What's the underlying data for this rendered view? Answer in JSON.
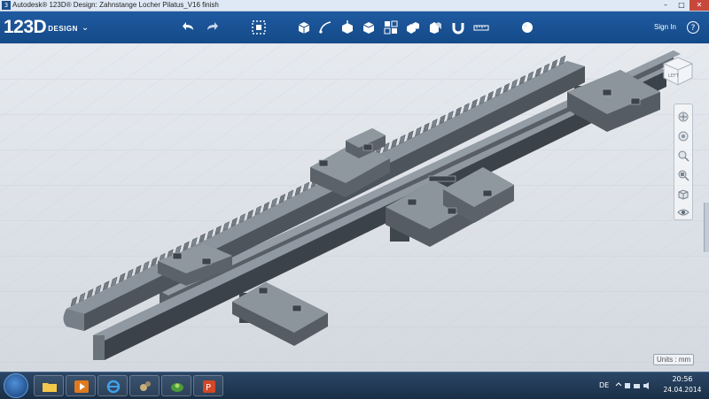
{
  "window": {
    "title": "Autodesk® 123D® Design: Zahnstange Locher Pilatus_V16 finish",
    "minimize": "–",
    "maximize": "□",
    "close": "✕"
  },
  "toolbar": {
    "logo_main": "123D",
    "logo_sub": "DESIGN",
    "logo_chevron": "⌄",
    "sign_in": "Sign In",
    "help": "?",
    "icons": [
      "undo-icon",
      "redo-icon",
      "transform-icon",
      "primitives-icon",
      "sketch-icon",
      "construct-icon",
      "modify-icon",
      "pattern-icon",
      "grouping-icon",
      "combine-icon",
      "snap-icon",
      "measure-icon",
      "material-icon"
    ]
  },
  "viewport": {
    "viewcube_label": "LEFT",
    "units": "Units : mm",
    "colors": {
      "part": "#707882",
      "part_dark": "#4a5058",
      "part_top": "#8a929b",
      "background": "#dde2e8"
    }
  },
  "taskbar": {
    "apps": [
      "explorer",
      "media-player",
      "internet-explorer",
      "app-gears",
      "app-green",
      "powerpoint"
    ],
    "language": "DE",
    "time": "20:56",
    "date": "24.04.2014"
  }
}
